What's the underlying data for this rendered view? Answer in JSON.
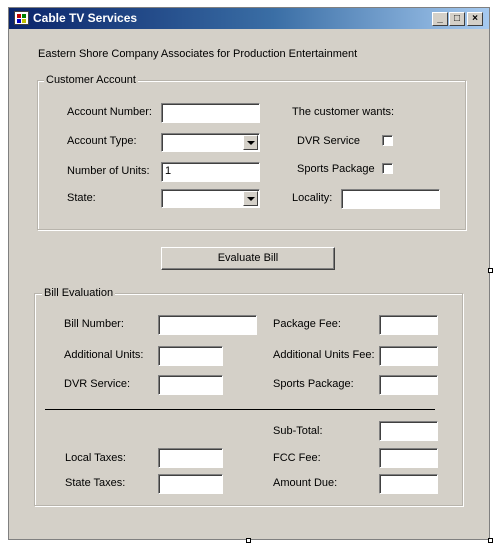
{
  "window": {
    "title": "Cable TV Services",
    "minimize": "_",
    "maximize": "□",
    "close": "×"
  },
  "company": "Eastern Shore Company Associates for Production Entertainment",
  "customer": {
    "legend": "Customer Account",
    "account_number_label": "Account Number:",
    "account_number_value": "",
    "account_type_label": "Account Type:",
    "account_type_value": "",
    "units_label": "Number of Units:",
    "units_value": "1",
    "state_label": "State:",
    "state_value": "",
    "wants_label": "The customer wants:",
    "dvr_label": "DVR Service",
    "sports_label": "Sports Package",
    "locality_label": "Locality:",
    "locality_value": ""
  },
  "evaluate_button": "Evaluate Bill",
  "bill": {
    "legend": "Bill Evaluation",
    "bill_number_label": "Bill Number:",
    "additional_units_label": "Additional Units:",
    "dvr_service_label": "DVR Service:",
    "package_fee_label": "Package Fee:",
    "additional_units_fee_label": "Additional Units Fee:",
    "sports_package_label": "Sports Package:",
    "subtotal_label": "Sub-Total:",
    "local_taxes_label": "Local Taxes:",
    "fcc_fee_label": "FCC Fee:",
    "state_taxes_label": "State Taxes:",
    "amount_due_label": "Amount Due:"
  }
}
